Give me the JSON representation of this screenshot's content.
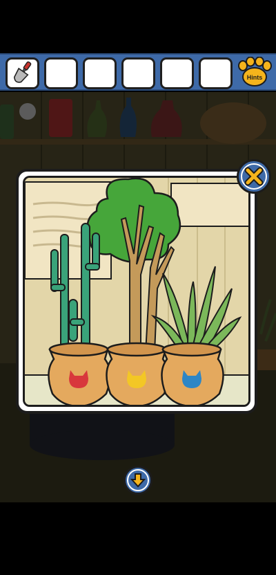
{
  "inventory": {
    "slots": [
      {
        "item": "trowel"
      },
      {
        "item": ""
      },
      {
        "item": ""
      },
      {
        "item": ""
      },
      {
        "item": ""
      },
      {
        "item": ""
      }
    ]
  },
  "hints": {
    "label": "Hints",
    "icon": "paw-icon"
  },
  "modal": {
    "close_icon": "close-icon",
    "pots": [
      {
        "plant": "cactus",
        "mark_color": "#d8373c"
      },
      {
        "plant": "tree",
        "mark_color": "#f3c725"
      },
      {
        "plant": "aloe",
        "mark_color": "#2d86c6"
      }
    ]
  },
  "navigation": {
    "down_icon": "arrow-down-icon"
  },
  "colors": {
    "bar": "#3e6aa8",
    "accent": "#f5b41c"
  }
}
